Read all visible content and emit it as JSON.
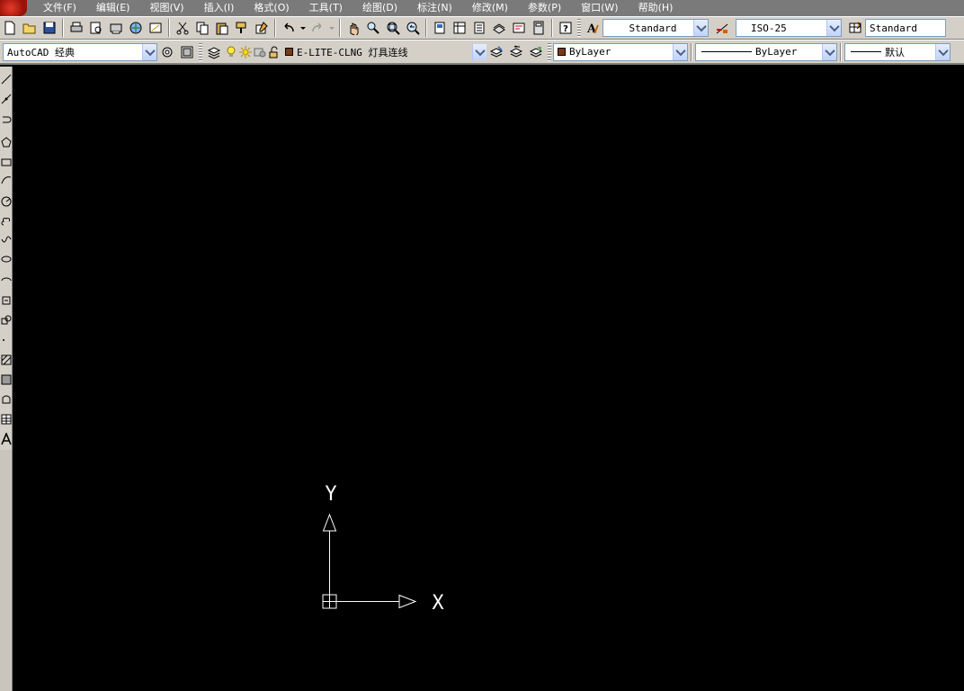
{
  "menu": {
    "items": [
      "文件(F)",
      "编辑(E)",
      "视图(V)",
      "插入(I)",
      "格式(O)",
      "工具(T)",
      "绘图(D)",
      "标注(N)",
      "修改(M)",
      "参数(P)",
      "窗口(W)",
      "帮助(H)"
    ]
  },
  "toolbar1": {
    "text_style": "Standard",
    "dim_style": "ISO-25",
    "table_style": "Standard"
  },
  "toolbar2": {
    "workspace": "AutoCAD 经典",
    "layer": "E-LITE-CLNG 灯具连线",
    "color": "ByLayer",
    "linetype": "ByLayer",
    "lineweight": "默认"
  },
  "ucs": {
    "x_label": "X",
    "y_label": "Y"
  },
  "colors": {
    "canvas": "#000000",
    "toolbar": "#d4d0c8",
    "menubar": "#7a7a7a",
    "layer_color": "#7a3a12"
  }
}
